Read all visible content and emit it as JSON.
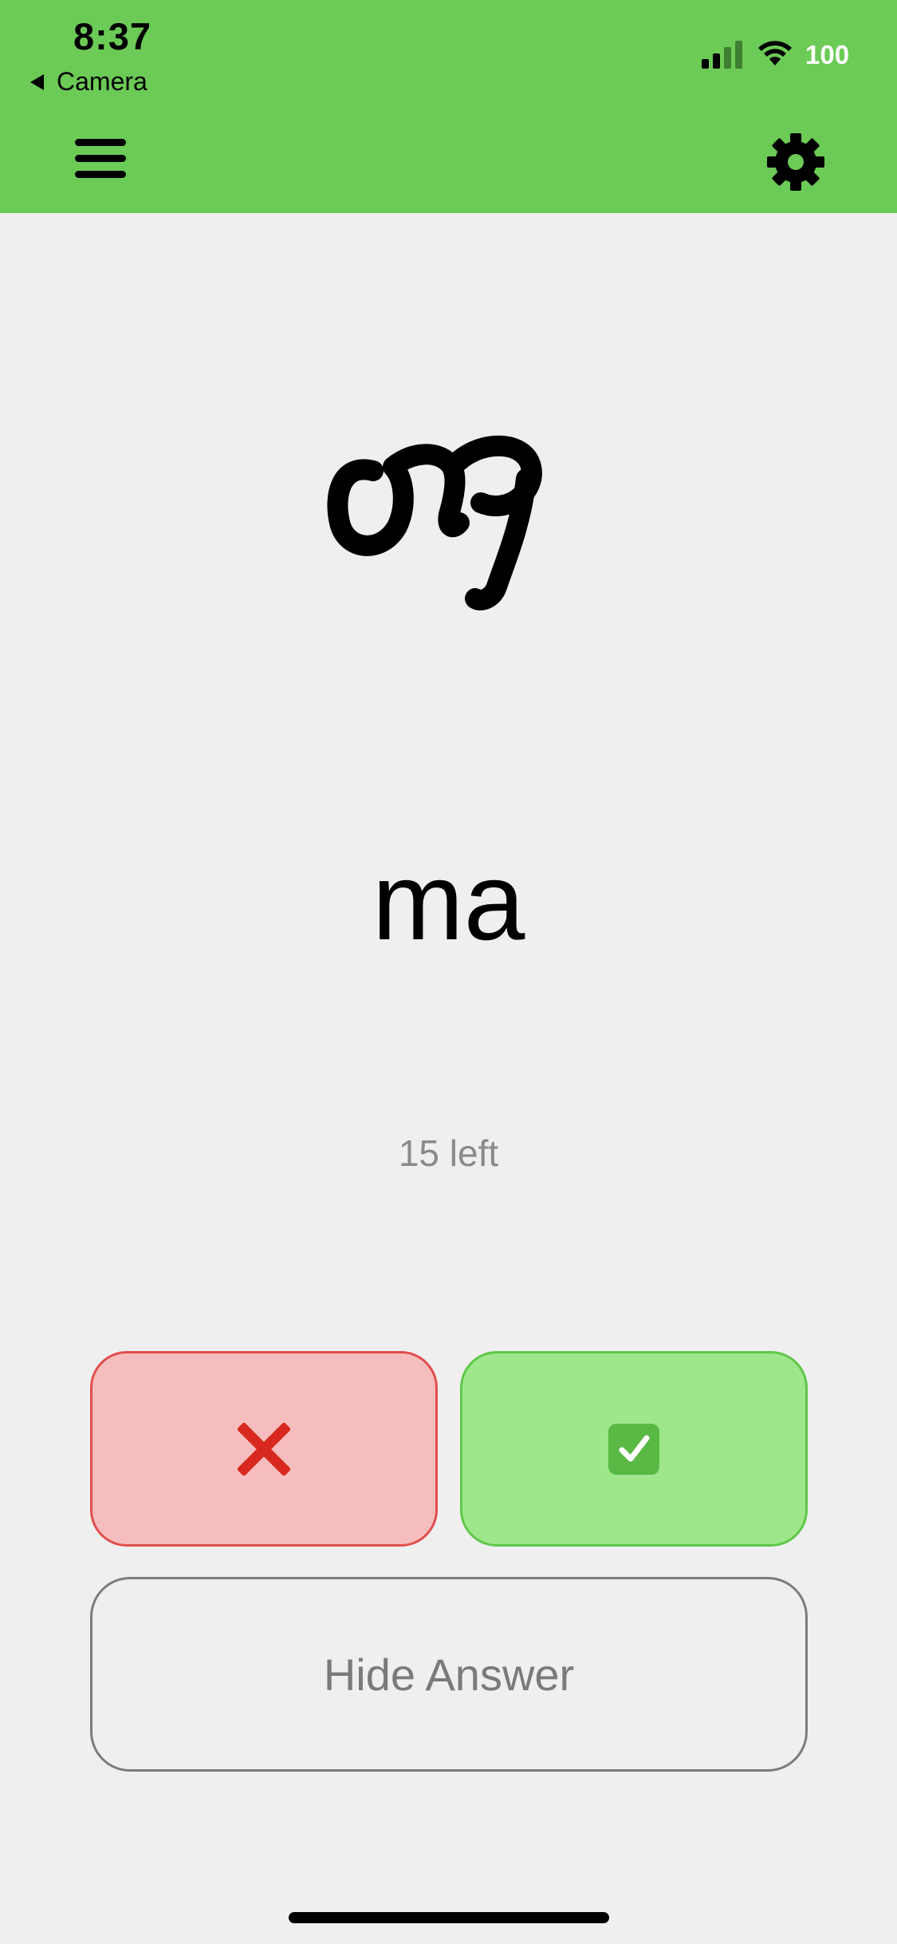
{
  "status_bar": {
    "time": "8:37",
    "back_app": "Camera",
    "battery": "100"
  },
  "header": {
    "menu_icon": "hamburger-menu-icon",
    "settings_icon": "gear-icon",
    "background_color": "#6ccb56"
  },
  "card": {
    "character": "መ",
    "answer": "ma",
    "remaining": "15 left"
  },
  "actions": {
    "wrong_icon": "cross-mark-icon",
    "right_icon": "check-mark-icon",
    "hide_answer_label": "Hide Answer"
  },
  "colors": {
    "wrong_bg": "#f5bdbd",
    "wrong_border": "#e24e4e",
    "right_bg": "#9ee78b",
    "right_border": "#5fc748"
  }
}
